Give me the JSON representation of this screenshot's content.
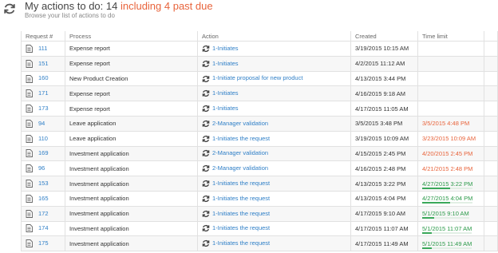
{
  "header": {
    "title_prefix": "My actions to do: 14 ",
    "title_due": "including 4 past due",
    "subtitle": "Browse your list of actions to do"
  },
  "table": {
    "columns": [
      "Request #",
      "Process",
      "Action",
      "Created",
      "Time limit"
    ],
    "rows": [
      {
        "req": "111",
        "process": "Expense report",
        "action": "1-Initiates",
        "created": "3/19/2015 10:15 AM",
        "limit": "",
        "status": "none",
        "progress": 0
      },
      {
        "req": "151",
        "process": "Expense report",
        "action": "1-Initiates",
        "created": "4/2/2015 11:12 AM",
        "limit": "",
        "status": "none",
        "progress": 0
      },
      {
        "req": "160",
        "process": "New Product Creation",
        "action": "1-Initiate proposal for new product",
        "created": "4/13/2015 3:44 PM",
        "limit": "",
        "status": "none",
        "progress": 0
      },
      {
        "req": "171",
        "process": "Expense report",
        "action": "1-Initiates",
        "created": "4/16/2015 9:18 AM",
        "limit": "",
        "status": "none",
        "progress": 0
      },
      {
        "req": "173",
        "process": "Expense report",
        "action": "1-Initiates",
        "created": "4/17/2015 11:05 AM",
        "limit": "",
        "status": "none",
        "progress": 0
      },
      {
        "req": "94",
        "process": "Leave application",
        "action": "2-Manager validation",
        "created": "3/5/2015 3:48 PM",
        "limit": "3/5/2015 4:48 PM",
        "status": "due",
        "progress": 0
      },
      {
        "req": "110",
        "process": "Leave application",
        "action": "1-Initiates the request",
        "created": "3/19/2015 10:09 AM",
        "limit": "3/23/2015 10:09 AM",
        "status": "due",
        "progress": 0
      },
      {
        "req": "169",
        "process": "Investment application",
        "action": "2-Manager validation",
        "created": "4/15/2015 2:45 PM",
        "limit": "4/20/2015 2:45 PM",
        "status": "due",
        "progress": 0
      },
      {
        "req": "96",
        "process": "Investment application",
        "action": "2-Manager validation",
        "created": "4/16/2015 2:48 PM",
        "limit": "4/21/2015 2:48 PM",
        "status": "due",
        "progress": 0
      },
      {
        "req": "153",
        "process": "Investment application",
        "action": "1-Initiates the request",
        "created": "4/13/2015 3:22 PM",
        "limit": "4/27/2015 3:22 PM",
        "status": "ok",
        "progress": 0.55
      },
      {
        "req": "165",
        "process": "Investment application",
        "action": "1-Initiates the request",
        "created": "4/13/2015 4:04 PM",
        "limit": "4/27/2015 4:04 PM",
        "status": "ok",
        "progress": 0.55
      },
      {
        "req": "172",
        "process": "Investment application",
        "action": "1-Initiates the request",
        "created": "4/17/2015 9:10 AM",
        "limit": "5/1/2015 9:10 AM",
        "status": "ok",
        "progress": 0.25
      },
      {
        "req": "174",
        "process": "Investment application",
        "action": "1-Initiates the request",
        "created": "4/17/2015 11:07 AM",
        "limit": "5/1/2015 11:07 AM",
        "status": "ok",
        "progress": 0.2
      },
      {
        "req": "175",
        "process": "Investment application",
        "action": "1-Initiates the request",
        "created": "4/17/2015 11:49 AM",
        "limit": "5/1/2015 11:49 AM",
        "status": "ok",
        "progress": 0.2
      }
    ]
  },
  "icons": {
    "header": "refresh-icon",
    "row": "document-icon",
    "action": "refresh-icon"
  },
  "colors": {
    "link": "#2f7fc7",
    "due": "#e8643c",
    "ok": "#2c9a4a"
  }
}
